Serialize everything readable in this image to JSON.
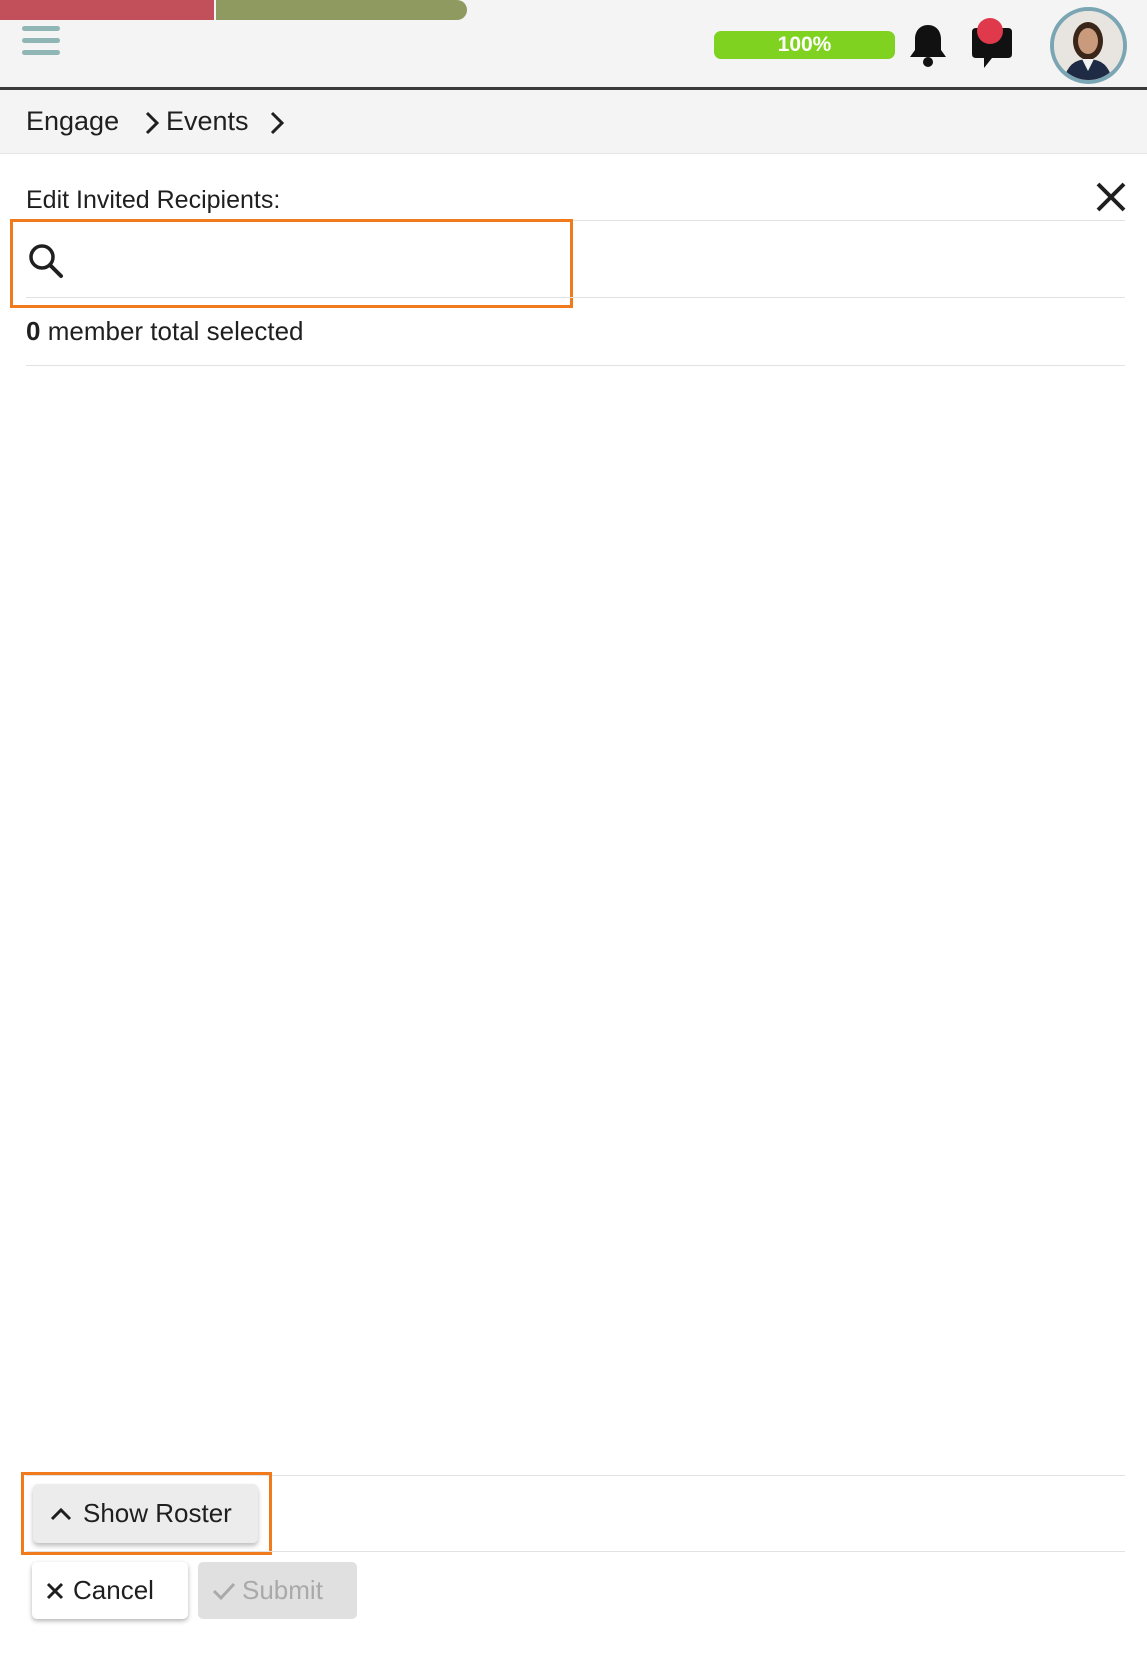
{
  "header": {
    "progress_badge": "100%",
    "icons": [
      "menu-icon",
      "bell-icon",
      "chat-icon",
      "avatar"
    ],
    "colors": {
      "accent_green": "#7fd21f",
      "progress_red": "#c2505a",
      "progress_olive": "#8e9a5f",
      "highlight": "#f07a1c"
    }
  },
  "breadcrumb": {
    "items": [
      "Engage",
      "Events"
    ]
  },
  "dialog": {
    "title": "Edit Invited Recipients:",
    "search_value": "",
    "count_number": "0",
    "count_text": "member total selected",
    "show_roster_label": "Show Roster",
    "cancel_label": "Cancel",
    "submit_label": "Submit"
  }
}
